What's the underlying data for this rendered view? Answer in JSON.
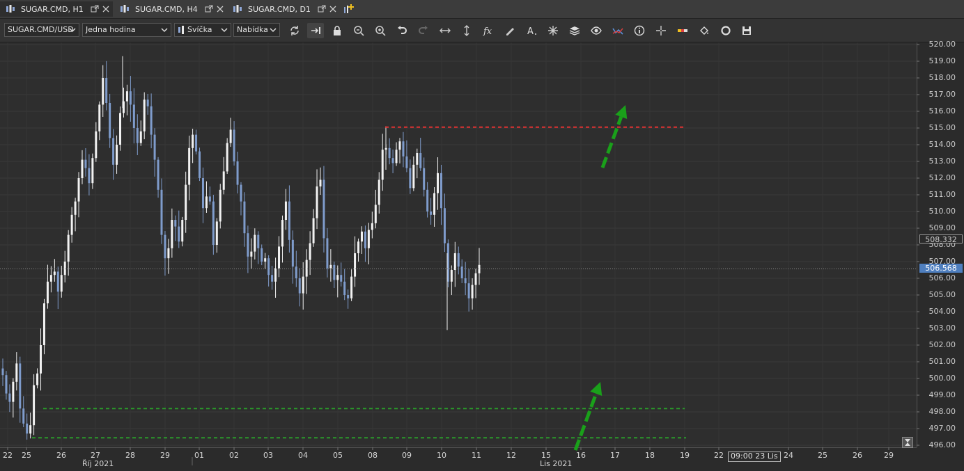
{
  "tabs": [
    {
      "label": "SUGAR.CMD, H1",
      "active": true
    },
    {
      "label": "SUGAR.CMD, H4",
      "active": false
    },
    {
      "label": "SUGAR.CMD, D1",
      "active": false
    }
  ],
  "toolbar": {
    "symbol": "SUGAR.CMD/USD",
    "timeframe": "Jedna hodina",
    "chart_type": "Svíčka",
    "offer": "Nabídka",
    "icons": [
      "refresh-icon",
      "autoscroll-icon",
      "lock-icon",
      "zoom-out-icon",
      "zoom-in-icon",
      "undo-icon",
      "redo-icon",
      "horizontal-resize-icon",
      "vertical-resize-icon",
      "function-icon",
      "pencil-icon",
      "text-icon",
      "star-icon",
      "layers-icon",
      "eye-icon",
      "indicator-icon",
      "info-icon",
      "crosshair-icon",
      "color-bar-icon",
      "paint-bucket-icon",
      "circle-icon",
      "save-icon"
    ]
  },
  "price_axis": {
    "labels": [
      "520.00",
      "519.00",
      "518.00",
      "517.00",
      "516.00",
      "515.00",
      "514.00",
      "513.00",
      "512.00",
      "511.00",
      "510.00",
      "509.00",
      "508.00",
      "507.00",
      "506.00",
      "505.00",
      "504.00",
      "503.00",
      "502.00",
      "501.00",
      "500.00",
      "499.00",
      "498.00",
      "497.00",
      "496.00"
    ],
    "ask_price": "508.332",
    "bid_price": "506.568"
  },
  "time_axis": {
    "days": [
      "22",
      "25",
      "26",
      "27",
      "28",
      "29",
      "01",
      "02",
      "03",
      "04",
      "05",
      "08",
      "09",
      "10",
      "11",
      "12",
      "15",
      "16",
      "17",
      "18",
      "19",
      "22",
      "24",
      "25",
      "26",
      "29"
    ],
    "months": [
      "Říj 2021",
      "Lis 2021"
    ],
    "cursor_time": "09:00 23 Lis"
  },
  "chart_data": {
    "type": "candlestick",
    "symbol": "SUGAR.CMD/USD",
    "timeframe": "H1",
    "ylim": [
      496.0,
      520.0
    ],
    "grid": true,
    "levels": [
      {
        "price": 515.05,
        "color": "#e03030",
        "style": "dashed"
      },
      {
        "price": 498.2,
        "color": "#2a9a2a",
        "style": "dashed"
      },
      {
        "price": 496.45,
        "color": "#2a9a2a",
        "style": "dashed"
      }
    ],
    "arrows": [
      {
        "color": "#1aa01a",
        "direction": "up"
      },
      {
        "color": "#1aa01a",
        "direction": "up"
      }
    ],
    "close_path": [
      500.2,
      499.1,
      498.6,
      499.8,
      500.9,
      498.2,
      497.3,
      496.7,
      497.2,
      499.6,
      500.3,
      502.0,
      504.5,
      505.8,
      506.2,
      506.4,
      505.2,
      506.2,
      507.0,
      508.6,
      509.8,
      510.6,
      512.0,
      513.1,
      512.6,
      511.7,
      513.2,
      514.8,
      516.4,
      518.0,
      516.5,
      514.4,
      512.8,
      514.0,
      515.9,
      516.6,
      517.2,
      516.4,
      515.0,
      514.1,
      514.8,
      516.7,
      516.3,
      514.6,
      513.1,
      511.3,
      508.6,
      507.2,
      507.8,
      509.5,
      509.1,
      508.2,
      509.5,
      511.6,
      513.8,
      514.6,
      513.6,
      512.0,
      510.2,
      510.9,
      510.6,
      508.0,
      509.4,
      511.3,
      512.4,
      514.1,
      514.9,
      513.0,
      511.6,
      510.6,
      508.7,
      507.3,
      507.6,
      508.6,
      507.8,
      507.0,
      507.2,
      506.2,
      505.8,
      506.6,
      507.9,
      509.5,
      510.6,
      508.3,
      506.7,
      506.0,
      505.1,
      506.1,
      507.1,
      508.1,
      509.6,
      511.5,
      511.9,
      508.4,
      506.6,
      506.8,
      505.9,
      506.2,
      505.8,
      505.0,
      504.8,
      506.1,
      507.5,
      508.2,
      508.8,
      507.8,
      508.9,
      509.3,
      510.4,
      511.9,
      513.7,
      513.8,
      513.2,
      512.9,
      513.7,
      514.2,
      513.3,
      512.6,
      511.4,
      512.8,
      513.5,
      512.6,
      511.3,
      510.0,
      509.8,
      511.1,
      512.3,
      510.2,
      508.1,
      505.8,
      506.5,
      507.5,
      506.7,
      506.0,
      505.7,
      504.8,
      505.6,
      506.3,
      506.8
    ],
    "close_path_note": ""
  }
}
